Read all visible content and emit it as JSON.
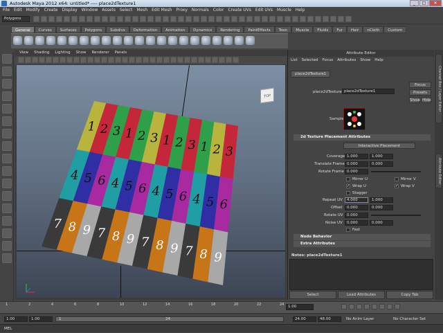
{
  "window": {
    "title": "Autodesk Maya 2012 x64: untitled*   ----   place2dTexture1"
  },
  "menubar": [
    "File",
    "Edit",
    "Modify",
    "Create",
    "Display",
    "Window",
    "Assets",
    "Select",
    "Mesh",
    "Edit Mesh",
    "Proxy",
    "Normals",
    "Color",
    "Create UVs",
    "Edit UVs",
    "Muscle",
    "Help"
  ],
  "statusline": {
    "mode": "Polygons"
  },
  "shelf": {
    "tabs": [
      "General",
      "Curves",
      "Surfaces",
      "Polygons",
      "Subdivs",
      "Deformation",
      "Animation",
      "Dynamics",
      "Rendering",
      "PaintEffects",
      "Toon",
      "Muscle",
      "Fluids",
      "Fur",
      "Hair",
      "nCloth",
      "Custom"
    ],
    "active": "General"
  },
  "panel": {
    "menu": [
      "View",
      "Shading",
      "Lighting",
      "Show",
      "Renderer",
      "Panels"
    ],
    "viewcube": "TOP"
  },
  "texture": {
    "colors_rows": [
      [
        "#b9b43e",
        "#c4263a",
        "#2fa04a",
        "#c4263a",
        "#2fa04a",
        "#b9b43e",
        "#c4263a",
        "#2fa04a",
        "#c4263a",
        "#2fa04a",
        "#b9b43e",
        "#c4263a"
      ],
      [
        "#1f9ea4",
        "#2f2ea5",
        "#a92aa0",
        "#1f9ea4",
        "#2f2ea5",
        "#a92aa0",
        "#1f9ea4",
        "#2f2ea5",
        "#a92aa0",
        "#1f9ea4",
        "#2f2ea5",
        "#a92aa0"
      ],
      [
        "#3a3a3a",
        "#c77516",
        "#a8a8a8",
        "#3a3a3a",
        "#c77516",
        "#a8a8a8",
        "#3a3a3a",
        "#c77516",
        "#a8a8a8",
        "#3a3a3a",
        "#c77516",
        "#a8a8a8"
      ]
    ],
    "labels_rows": [
      [
        "1",
        "2",
        "3",
        "1",
        "2",
        "3",
        "1",
        "2",
        "3",
        "1",
        "2",
        "3"
      ],
      [
        "4",
        "5",
        "6",
        "4",
        "5",
        "6",
        "4",
        "5",
        "6",
        "4",
        "5",
        "6"
      ],
      [
        "7",
        "8",
        "9",
        "7",
        "8",
        "9",
        "7",
        "8",
        "9",
        "7",
        "8",
        "9"
      ]
    ]
  },
  "attr": {
    "title": "Attribute Editor",
    "menu": [
      "List",
      "Selected",
      "Focus",
      "Attributes",
      "Show",
      "Help"
    ],
    "node_tab": "place2dTexture1",
    "node_label": "place2dTexture:",
    "node_name": "place2dTexture1",
    "focus": "Focus",
    "presets": "Presets",
    "show": "Show",
    "hide": "Hide",
    "sample_label": "Sample",
    "section_title": "2d Texture Placement Attributes",
    "interactive": "Interactive Placement",
    "coverage_label": "Coverage",
    "coverage": [
      "1.000",
      "1.000"
    ],
    "translate_label": "Translate Frame",
    "translate": [
      "0.000",
      "0.000"
    ],
    "rotate_frame_label": "Rotate Frame",
    "rotate_frame": "0.000",
    "mirror_u": "Mirror U",
    "mirror_v": "Mirror V",
    "wrap_u": "Wrap U",
    "wrap_v": "Wrap V",
    "stagger": "Stagger",
    "repeat_label": "Repeat UV",
    "repeat": [
      "4.000",
      "1.000"
    ],
    "offset_label": "Offset",
    "offset": [
      "0.000",
      "0.000"
    ],
    "rotate_uv_label": "Rotate UV",
    "rotate_uv": "0.000",
    "noise_label": "Noise UV",
    "noise": [
      "0.000",
      "0.000"
    ],
    "fast": "Fast",
    "node_behavior": "Node Behavior",
    "extra": "Extra Attributes",
    "notes": "Notes: place2dTexture1",
    "select": "Select",
    "load": "Load Attributes",
    "copy": "Copy Tab"
  },
  "sidetabs": [
    "Channel Box / Layer Editor",
    "Attribute Editor"
  ],
  "timeline": {
    "ticks": [
      "1",
      "2",
      "4",
      "6",
      "8",
      "10",
      "12",
      "14",
      "16",
      "18",
      "20",
      "22",
      "24"
    ],
    "current": "1.00"
  },
  "range": {
    "start": "1.00",
    "start2": "1.00",
    "mid": "1",
    "end_inner": "24",
    "end": "24.00",
    "end2": "48.00",
    "anim_layer": "No Anim Layer",
    "char_set": "No Character Set"
  },
  "help": {
    "label": "MEL"
  }
}
